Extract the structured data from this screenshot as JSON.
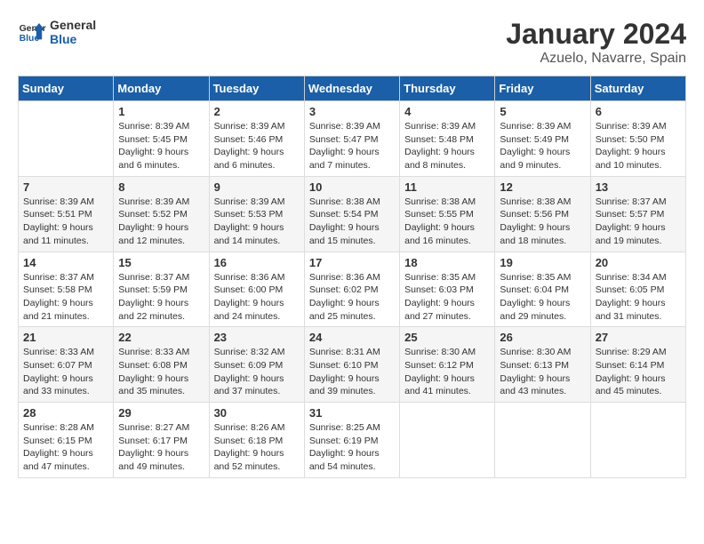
{
  "logo": {
    "line1": "General",
    "line2": "Blue"
  },
  "title": "January 2024",
  "subtitle": "Azuelo, Navarre, Spain",
  "days_header": [
    "Sunday",
    "Monday",
    "Tuesday",
    "Wednesday",
    "Thursday",
    "Friday",
    "Saturday"
  ],
  "weeks": [
    [
      {
        "day": "",
        "info": ""
      },
      {
        "day": "1",
        "info": "Sunrise: 8:39 AM\nSunset: 5:45 PM\nDaylight: 9 hours\nand 6 minutes."
      },
      {
        "day": "2",
        "info": "Sunrise: 8:39 AM\nSunset: 5:46 PM\nDaylight: 9 hours\nand 6 minutes."
      },
      {
        "day": "3",
        "info": "Sunrise: 8:39 AM\nSunset: 5:47 PM\nDaylight: 9 hours\nand 7 minutes."
      },
      {
        "day": "4",
        "info": "Sunrise: 8:39 AM\nSunset: 5:48 PM\nDaylight: 9 hours\nand 8 minutes."
      },
      {
        "day": "5",
        "info": "Sunrise: 8:39 AM\nSunset: 5:49 PM\nDaylight: 9 hours\nand 9 minutes."
      },
      {
        "day": "6",
        "info": "Sunrise: 8:39 AM\nSunset: 5:50 PM\nDaylight: 9 hours\nand 10 minutes."
      }
    ],
    [
      {
        "day": "7",
        "info": "Sunrise: 8:39 AM\nSunset: 5:51 PM\nDaylight: 9 hours\nand 11 minutes."
      },
      {
        "day": "8",
        "info": "Sunrise: 8:39 AM\nSunset: 5:52 PM\nDaylight: 9 hours\nand 12 minutes."
      },
      {
        "day": "9",
        "info": "Sunrise: 8:39 AM\nSunset: 5:53 PM\nDaylight: 9 hours\nand 14 minutes."
      },
      {
        "day": "10",
        "info": "Sunrise: 8:38 AM\nSunset: 5:54 PM\nDaylight: 9 hours\nand 15 minutes."
      },
      {
        "day": "11",
        "info": "Sunrise: 8:38 AM\nSunset: 5:55 PM\nDaylight: 9 hours\nand 16 minutes."
      },
      {
        "day": "12",
        "info": "Sunrise: 8:38 AM\nSunset: 5:56 PM\nDaylight: 9 hours\nand 18 minutes."
      },
      {
        "day": "13",
        "info": "Sunrise: 8:37 AM\nSunset: 5:57 PM\nDaylight: 9 hours\nand 19 minutes."
      }
    ],
    [
      {
        "day": "14",
        "info": "Sunrise: 8:37 AM\nSunset: 5:58 PM\nDaylight: 9 hours\nand 21 minutes."
      },
      {
        "day": "15",
        "info": "Sunrise: 8:37 AM\nSunset: 5:59 PM\nDaylight: 9 hours\nand 22 minutes."
      },
      {
        "day": "16",
        "info": "Sunrise: 8:36 AM\nSunset: 6:00 PM\nDaylight: 9 hours\nand 24 minutes."
      },
      {
        "day": "17",
        "info": "Sunrise: 8:36 AM\nSunset: 6:02 PM\nDaylight: 9 hours\nand 25 minutes."
      },
      {
        "day": "18",
        "info": "Sunrise: 8:35 AM\nSunset: 6:03 PM\nDaylight: 9 hours\nand 27 minutes."
      },
      {
        "day": "19",
        "info": "Sunrise: 8:35 AM\nSunset: 6:04 PM\nDaylight: 9 hours\nand 29 minutes."
      },
      {
        "day": "20",
        "info": "Sunrise: 8:34 AM\nSunset: 6:05 PM\nDaylight: 9 hours\nand 31 minutes."
      }
    ],
    [
      {
        "day": "21",
        "info": "Sunrise: 8:33 AM\nSunset: 6:07 PM\nDaylight: 9 hours\nand 33 minutes."
      },
      {
        "day": "22",
        "info": "Sunrise: 8:33 AM\nSunset: 6:08 PM\nDaylight: 9 hours\nand 35 minutes."
      },
      {
        "day": "23",
        "info": "Sunrise: 8:32 AM\nSunset: 6:09 PM\nDaylight: 9 hours\nand 37 minutes."
      },
      {
        "day": "24",
        "info": "Sunrise: 8:31 AM\nSunset: 6:10 PM\nDaylight: 9 hours\nand 39 minutes."
      },
      {
        "day": "25",
        "info": "Sunrise: 8:30 AM\nSunset: 6:12 PM\nDaylight: 9 hours\nand 41 minutes."
      },
      {
        "day": "26",
        "info": "Sunrise: 8:30 AM\nSunset: 6:13 PM\nDaylight: 9 hours\nand 43 minutes."
      },
      {
        "day": "27",
        "info": "Sunrise: 8:29 AM\nSunset: 6:14 PM\nDaylight: 9 hours\nand 45 minutes."
      }
    ],
    [
      {
        "day": "28",
        "info": "Sunrise: 8:28 AM\nSunset: 6:15 PM\nDaylight: 9 hours\nand 47 minutes."
      },
      {
        "day": "29",
        "info": "Sunrise: 8:27 AM\nSunset: 6:17 PM\nDaylight: 9 hours\nand 49 minutes."
      },
      {
        "day": "30",
        "info": "Sunrise: 8:26 AM\nSunset: 6:18 PM\nDaylight: 9 hours\nand 52 minutes."
      },
      {
        "day": "31",
        "info": "Sunrise: 8:25 AM\nSunset: 6:19 PM\nDaylight: 9 hours\nand 54 minutes."
      },
      {
        "day": "",
        "info": ""
      },
      {
        "day": "",
        "info": ""
      },
      {
        "day": "",
        "info": ""
      }
    ]
  ]
}
